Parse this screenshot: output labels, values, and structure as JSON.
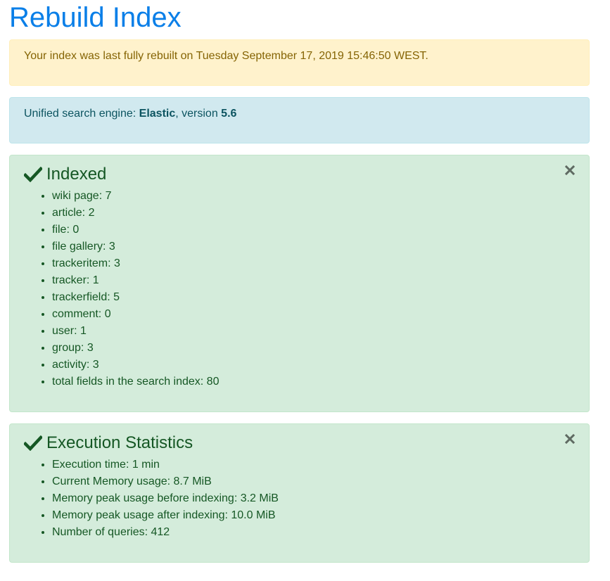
{
  "page": {
    "title": "Rebuild Index"
  },
  "warning_alert": {
    "text": "Your index was last fully rebuilt on Tuesday September 17, 2019 15:46:50 WEST."
  },
  "info_alert": {
    "prefix": "Unified search engine: ",
    "engine": "Elastic",
    "middle": ", version ",
    "version": "5.6"
  },
  "indexed_panel": {
    "icon": "check-icon",
    "heading": "Indexed",
    "close_icon": "close-icon",
    "items": [
      {
        "label": "wiki page: 7"
      },
      {
        "label": "article: 2"
      },
      {
        "label": "file: 0"
      },
      {
        "label": "file gallery: 3"
      },
      {
        "label": "trackeritem: 3"
      },
      {
        "label": "tracker: 1"
      },
      {
        "label": "trackerfield: 5"
      },
      {
        "label": "comment: 0"
      },
      {
        "label": "user: 1"
      },
      {
        "label": "group: 3"
      },
      {
        "label": "activity: 3"
      },
      {
        "label": "total fields in the search index: 80"
      }
    ]
  },
  "stats_panel": {
    "icon": "check-icon",
    "heading": "Execution Statistics",
    "close_icon": "close-icon",
    "items": [
      {
        "label": "Execution time: 1 min"
      },
      {
        "label": "Current Memory usage: 8.7 MiB"
      },
      {
        "label": "Memory peak usage before indexing: 3.2 MiB"
      },
      {
        "label": "Memory peak usage after indexing: 10.0 MiB"
      },
      {
        "label": "Number of queries: 412"
      }
    ]
  },
  "colors": {
    "title": "#0a7fe8",
    "warning_bg": "#fff2cc",
    "info_bg": "#d1e9ef",
    "success_bg": "#d4ecdb",
    "success_text": "#155724"
  }
}
